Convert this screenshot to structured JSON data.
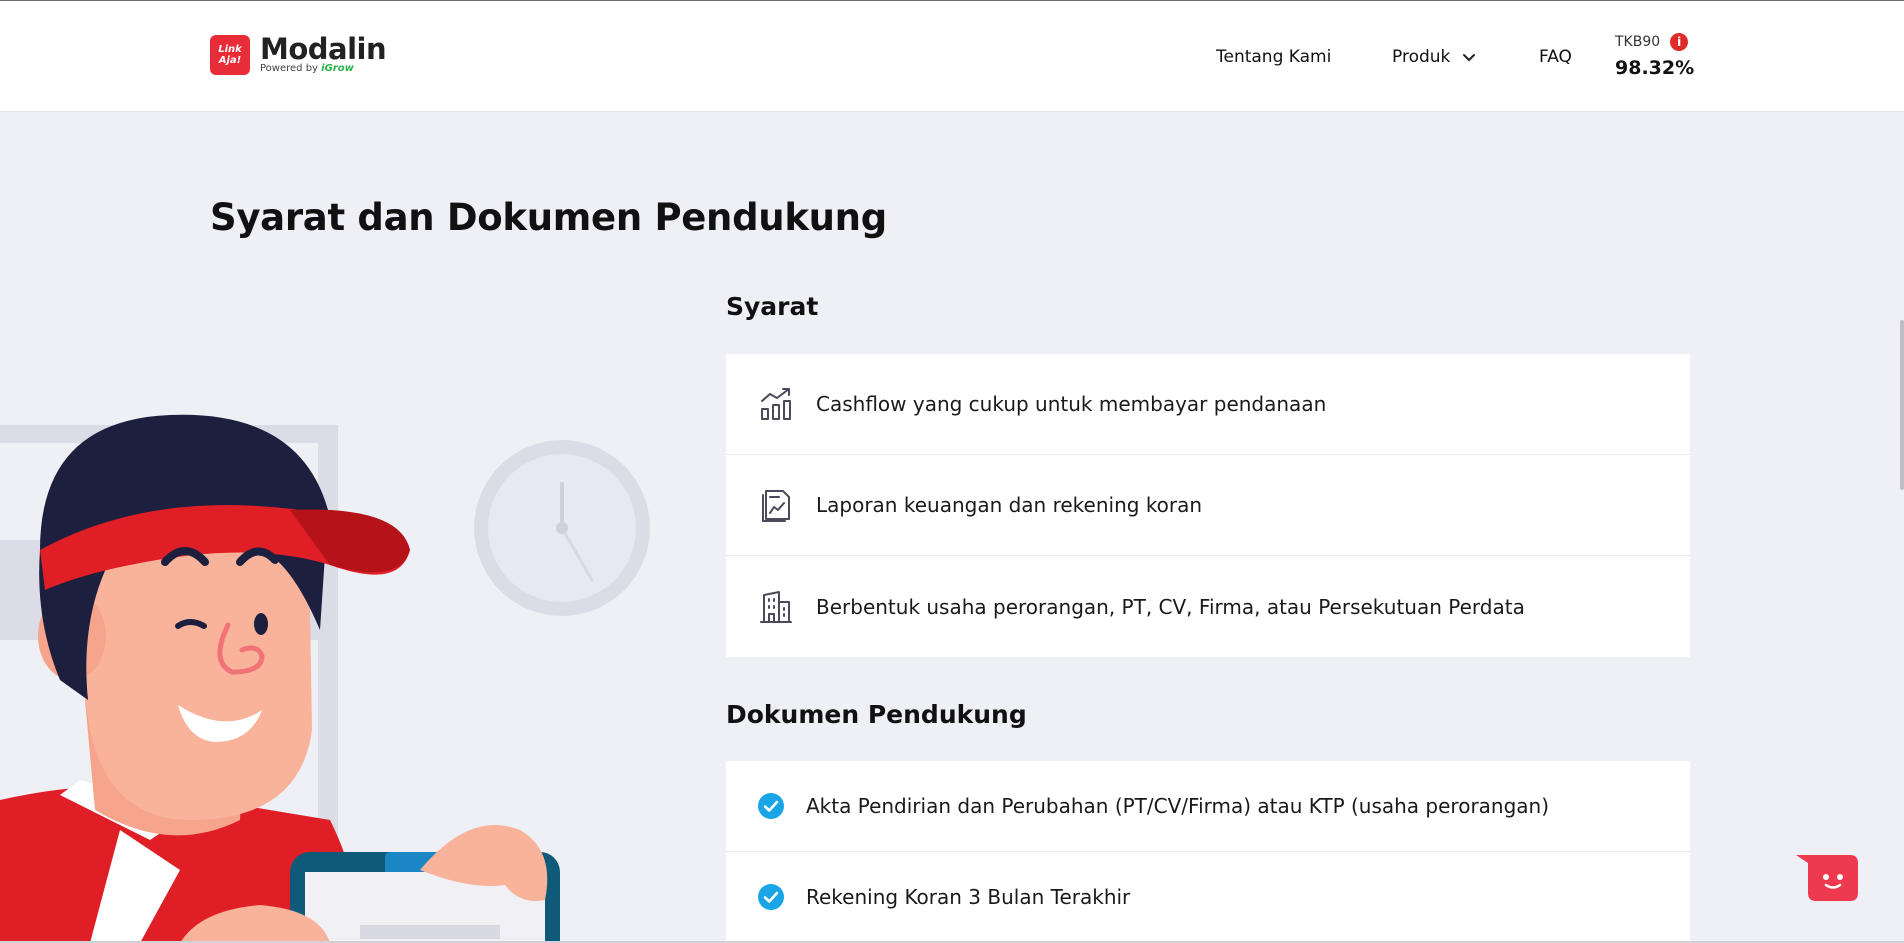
{
  "header": {
    "logo_badge": "Link Aja!",
    "logo_name": "Modalin",
    "powered_by": "Powered by",
    "powered_brand": "iGrow",
    "nav": {
      "about": "Tentang Kami",
      "product": "Produk",
      "faq": "FAQ"
    },
    "tkb": {
      "label": "TKB90",
      "value": "98.32%"
    }
  },
  "page_title": "Syarat dan Dokumen Pendukung",
  "syarat": {
    "title": "Syarat",
    "items": [
      {
        "icon": "chart-growth-icon",
        "text": "Cashflow yang cukup untuk membayar pendanaan"
      },
      {
        "icon": "report-document-icon",
        "text": "Laporan keuangan dan rekening koran"
      },
      {
        "icon": "building-icon",
        "text": "Berbentuk usaha perorangan, PT, CV, Firma, atau Persekutuan Perdata"
      }
    ]
  },
  "dokumen": {
    "title": "Dokumen Pendukung",
    "items": [
      {
        "icon": "check-circle-icon",
        "text": "Akta Pendirian dan Perubahan (PT/CV/Firma) atau KTP (usaha perorangan)"
      },
      {
        "icon": "check-circle-icon",
        "text": "Rekening Koran 3 Bulan Terakhir"
      }
    ]
  },
  "colors": {
    "brand_red": "#e82c38",
    "check_blue": "#1aa6e6",
    "page_bg": "#efeff6"
  }
}
